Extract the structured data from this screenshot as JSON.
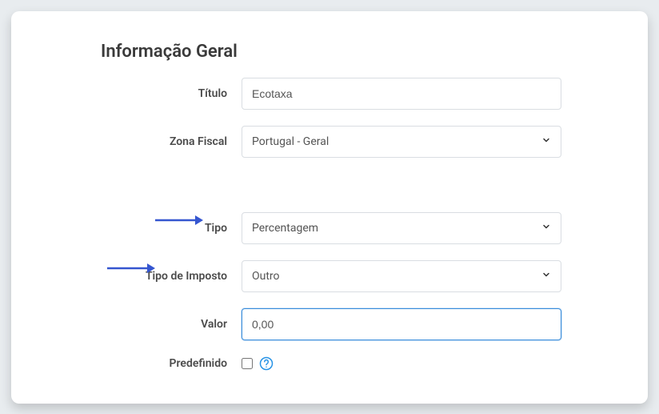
{
  "section_title": "Informação Geral",
  "fields": {
    "titulo": {
      "label": "Título",
      "value": "Ecotaxa"
    },
    "zona_fiscal": {
      "label": "Zona Fiscal",
      "value": "Portugal - Geral"
    },
    "tipo": {
      "label": "Tipo",
      "value": "Percentagem"
    },
    "tipo_imposto": {
      "label": "Tipo de Imposto",
      "value": "Outro"
    },
    "valor": {
      "label": "Valor",
      "value": "0,00"
    },
    "predefinido": {
      "label": "Predefinido"
    }
  }
}
